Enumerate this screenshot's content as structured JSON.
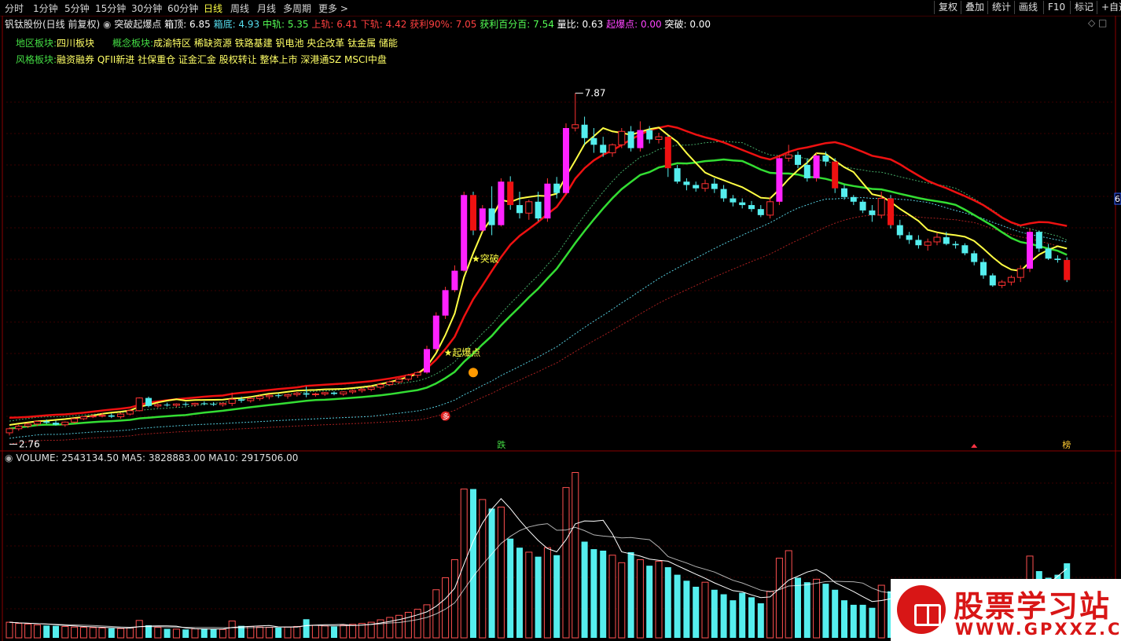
{
  "toolbar": {
    "periods": [
      "分时",
      "1分钟",
      "5分钟",
      "15分钟",
      "30分钟",
      "60分钟",
      "日线",
      "周线",
      "月线",
      "多周期",
      "更多 >"
    ],
    "active_period": "日线",
    "right_buttons": [
      "复权",
      "叠加",
      "统计",
      "画线",
      "F10",
      "标记",
      "+自选"
    ]
  },
  "info": {
    "stock": "钒钛股份(日线 前复权)",
    "formula": "突破起爆点",
    "indicators": [
      {
        "label": "箱顶: 6.85",
        "color": "#ffffff"
      },
      {
        "label": "箱底: 4.93",
        "color": "#55ddee"
      },
      {
        "label": "中轨: 5.35",
        "color": "#55ff55"
      },
      {
        "label": "上轨: 6.41",
        "color": "#ff4040"
      },
      {
        "label": "下轨: 4.42",
        "color": "#ff4040"
      },
      {
        "label": "获利90%: 7.05",
        "color": "#ff4040"
      },
      {
        "label": "获利百分百: 7.54",
        "color": "#55ff55"
      },
      {
        "label": "量比: 0.63",
        "color": "#ffffff"
      },
      {
        "label": "起爆点: 0.00",
        "color": "#ff44ff"
      },
      {
        "label": "突破: 0.00",
        "color": "#ffffff"
      }
    ]
  },
  "sectors": {
    "region_label": "地区板块:",
    "region_value": "四川板块",
    "concept_label": "概念板块:",
    "concept_value": "成渝特区 稀缺资源 铁路基建 钒电池 央企改革 钛金属 储能",
    "style_label": "风格板块:",
    "style_value": "融资融券 QFII新进 社保重仓 证金汇金 股权转让 整体上市 深港通SZ MSCI中盘"
  },
  "volume_info": {
    "text": "VOLUME: 2543134.50  MA5: 3828883.00  MA10: 2917506.00"
  },
  "annotations": {
    "high": "7.87",
    "low": "2.76",
    "breakout": "★突破",
    "ignition": "★起爆点",
    "right_edge": "6",
    "marker_die": "跌",
    "marker_bang": "榜",
    "marker_duo": "多"
  },
  "watermark": {
    "title": "股票学习站",
    "url": "WWW.GPXXZ.COM"
  },
  "colors": {
    "up": "#ff3232",
    "down": "#55eeee",
    "magenta": "#ff22ff",
    "yellow": "#ffff44",
    "green": "#33dd33",
    "red": "#ee1111"
  },
  "chart_data": {
    "type": "candlestick",
    "price_range": [
      2.6,
      8.3
    ],
    "volume_range": [
      0,
      5800000
    ],
    "candles": [
      [
        2.8,
        2.88,
        2.76,
        2.86
      ],
      [
        2.86,
        2.92,
        2.83,
        2.9
      ],
      [
        2.9,
        2.95,
        2.87,
        2.93
      ],
      [
        2.93,
        2.98,
        2.9,
        2.97
      ],
      [
        2.97,
        3.0,
        2.93,
        2.95
      ],
      [
        2.95,
        2.98,
        2.91,
        2.92
      ],
      [
        2.92,
        2.97,
        2.89,
        2.96
      ],
      [
        2.96,
        3.02,
        2.94,
        3.01
      ],
      [
        3.01,
        3.05,
        2.99,
        3.04
      ],
      [
        3.04,
        3.08,
        3.02,
        3.05
      ],
      [
        3.05,
        3.1,
        3.03,
        3.06
      ],
      [
        3.06,
        3.09,
        3.02,
        3.04
      ],
      [
        3.04,
        3.1,
        3.01,
        3.08
      ],
      [
        3.08,
        3.15,
        3.06,
        3.13
      ],
      [
        3.13,
        3.33,
        3.12,
        3.32
      ],
      [
        3.32,
        3.34,
        3.18,
        3.2
      ],
      [
        3.2,
        3.24,
        3.17,
        3.22
      ],
      [
        3.22,
        3.25,
        3.19,
        3.21
      ],
      [
        3.21,
        3.24,
        3.18,
        3.23
      ],
      [
        3.23,
        3.26,
        3.2,
        3.22
      ],
      [
        3.22,
        3.25,
        3.19,
        3.24
      ],
      [
        3.24,
        3.27,
        3.21,
        3.23
      ],
      [
        3.23,
        3.26,
        3.2,
        3.22
      ],
      [
        3.22,
        3.25,
        3.19,
        3.24
      ],
      [
        3.24,
        3.4,
        3.2,
        3.3
      ],
      [
        3.3,
        3.34,
        3.25,
        3.28
      ],
      [
        3.28,
        3.33,
        3.25,
        3.31
      ],
      [
        3.31,
        3.36,
        3.28,
        3.34
      ],
      [
        3.34,
        3.38,
        3.3,
        3.36
      ],
      [
        3.36,
        3.39,
        3.32,
        3.35
      ],
      [
        3.35,
        3.38,
        3.31,
        3.37
      ],
      [
        3.37,
        3.41,
        3.34,
        3.39
      ],
      [
        3.39,
        3.49,
        3.33,
        3.37
      ],
      [
        3.37,
        3.4,
        3.34,
        3.38
      ],
      [
        3.38,
        3.41,
        3.35,
        3.4
      ],
      [
        3.4,
        3.42,
        3.36,
        3.38
      ],
      [
        3.38,
        3.42,
        3.35,
        3.41
      ],
      [
        3.41,
        3.45,
        3.38,
        3.43
      ],
      [
        3.43,
        3.47,
        3.4,
        3.45
      ],
      [
        3.45,
        3.5,
        3.42,
        3.48
      ],
      [
        3.48,
        3.55,
        3.45,
        3.52
      ],
      [
        3.52,
        3.58,
        3.5,
        3.56
      ],
      [
        3.56,
        3.62,
        3.53,
        3.6
      ],
      [
        3.6,
        3.68,
        3.57,
        3.66
      ],
      [
        3.66,
        3.72,
        3.62,
        3.7
      ],
      [
        3.7,
        4.1,
        3.68,
        4.05
      ],
      [
        4.05,
        4.6,
        4.02,
        4.55
      ],
      [
        4.55,
        4.98,
        4.5,
        4.93
      ],
      [
        4.93,
        5.3,
        4.9,
        5.22
      ],
      [
        5.22,
        6.4,
        5.2,
        6.35
      ],
      [
        6.35,
        6.4,
        5.75,
        5.82
      ],
      [
        5.82,
        6.2,
        5.8,
        6.15
      ],
      [
        6.15,
        6.48,
        5.75,
        5.9
      ],
      [
        5.9,
        6.6,
        5.88,
        6.55
      ],
      [
        6.55,
        6.63,
        6.13,
        6.2
      ],
      [
        6.2,
        6.4,
        6.0,
        6.08
      ],
      [
        6.08,
        6.28,
        5.98,
        6.25
      ],
      [
        6.25,
        6.4,
        5.96,
        6.0
      ],
      [
        6.0,
        6.6,
        5.95,
        6.52
      ],
      [
        6.52,
        6.62,
        6.3,
        6.38
      ],
      [
        6.38,
        7.42,
        6.35,
        7.35
      ],
      [
        7.35,
        7.87,
        7.3,
        7.4
      ],
      [
        7.4,
        7.52,
        7.1,
        7.2
      ],
      [
        7.2,
        7.35,
        6.98,
        7.1
      ],
      [
        7.1,
        7.22,
        6.92,
        6.98
      ],
      [
        6.98,
        7.12,
        6.92,
        7.1
      ],
      [
        7.1,
        7.35,
        7.05,
        7.3
      ],
      [
        7.3,
        7.38,
        7.0,
        7.05
      ],
      [
        7.05,
        7.45,
        7.0,
        7.32
      ],
      [
        7.32,
        7.38,
        7.12,
        7.18
      ],
      [
        7.18,
        7.28,
        7.12,
        7.22
      ],
      [
        7.22,
        7.24,
        6.62,
        6.75
      ],
      [
        6.75,
        6.8,
        6.52,
        6.55
      ],
      [
        6.55,
        6.6,
        6.42,
        6.5
      ],
      [
        6.5,
        6.55,
        6.4,
        6.45
      ],
      [
        6.45,
        6.58,
        6.4,
        6.52
      ],
      [
        6.52,
        6.6,
        6.38,
        6.44
      ],
      [
        6.44,
        6.5,
        6.25,
        6.3
      ],
      [
        6.3,
        6.35,
        6.18,
        6.24
      ],
      [
        6.24,
        6.3,
        6.15,
        6.2
      ],
      [
        6.2,
        6.26,
        6.1,
        6.14
      ],
      [
        6.14,
        6.2,
        6.02,
        6.05
      ],
      [
        6.05,
        6.32,
        6.0,
        6.25
      ],
      [
        6.25,
        6.95,
        6.2,
        6.9
      ],
      [
        6.9,
        7.1,
        6.85,
        6.95
      ],
      [
        6.95,
        7.0,
        6.75,
        6.8
      ],
      [
        6.8,
        6.9,
        6.55,
        6.6
      ],
      [
        6.6,
        6.98,
        6.55,
        6.94
      ],
      [
        6.94,
        7.0,
        6.78,
        6.85
      ],
      [
        6.85,
        6.9,
        6.38,
        6.45
      ],
      [
        6.45,
        6.5,
        6.28,
        6.32
      ],
      [
        6.32,
        6.35,
        6.2,
        6.25
      ],
      [
        6.25,
        6.28,
        6.08,
        6.12
      ],
      [
        6.12,
        6.2,
        5.95,
        6.05
      ],
      [
        6.05,
        6.4,
        6.0,
        6.3
      ],
      [
        6.3,
        6.35,
        5.85,
        5.9
      ],
      [
        5.9,
        5.98,
        5.7,
        5.75
      ],
      [
        5.75,
        5.8,
        5.62,
        5.68
      ],
      [
        5.68,
        5.75,
        5.55,
        5.6
      ],
      [
        5.6,
        5.7,
        5.52,
        5.65
      ],
      [
        5.65,
        5.78,
        5.6,
        5.72
      ],
      [
        5.72,
        5.8,
        5.6,
        5.62
      ],
      [
        5.62,
        5.66,
        5.55,
        5.6
      ],
      [
        5.6,
        5.63,
        5.45,
        5.48
      ],
      [
        5.48,
        5.52,
        5.3,
        5.35
      ],
      [
        5.35,
        5.4,
        5.1,
        5.15
      ],
      [
        5.15,
        5.18,
        4.98,
        5.0
      ],
      [
        5.0,
        5.08,
        4.96,
        5.05
      ],
      [
        5.05,
        5.15,
        5.0,
        5.12
      ],
      [
        5.12,
        5.3,
        5.05,
        5.25
      ],
      [
        5.25,
        5.85,
        5.2,
        5.8
      ],
      [
        5.8,
        5.82,
        5.5,
        5.55
      ],
      [
        5.55,
        5.62,
        5.38,
        5.4
      ],
      [
        5.4,
        5.45,
        5.34,
        5.38
      ],
      [
        5.38,
        5.42,
        5.05,
        5.08
      ]
    ],
    "volume": [
      520000,
      480000,
      460000,
      430000,
      410000,
      400000,
      380000,
      360000,
      350000,
      340000,
      330000,
      320000,
      310000,
      330000,
      580000,
      420000,
      350000,
      300000,
      290000,
      280000,
      300000,
      310000,
      290000,
      280000,
      560000,
      400000,
      380000,
      360000,
      350000,
      340000,
      360000,
      380000,
      620000,
      420000,
      400000,
      380000,
      420000,
      450000,
      480000,
      520000,
      600000,
      680000,
      750000,
      850000,
      950000,
      1100000,
      1600000,
      2000000,
      2600000,
      4950000,
      4950000,
      4600000,
      4300000,
      4350000,
      3300000,
      3000000,
      2850000,
      2700000,
      3000000,
      2750000,
      5000000,
      5500000,
      3200000,
      2950000,
      2900000,
      2750000,
      2500000,
      2850000,
      2600000,
      2400000,
      2550000,
      2350000,
      2100000,
      1900000,
      1700000,
      1850000,
      1600000,
      1450000,
      1250000,
      1500000,
      1350000,
      1150000,
      1550000,
      2650000,
      2900000,
      2000000,
      1850000,
      1950000,
      1800000,
      1600000,
      1250000,
      1100000,
      1100000,
      1000000,
      1750000,
      1550000,
      1400000,
      1300000,
      1200000,
      1150000,
      1100000,
      1000000,
      950000,
      900000,
      1100000,
      1050000,
      900000,
      980000,
      850000,
      1200000,
      2720000,
      2220000,
      2000000,
      2100000,
      2480000
    ]
  }
}
